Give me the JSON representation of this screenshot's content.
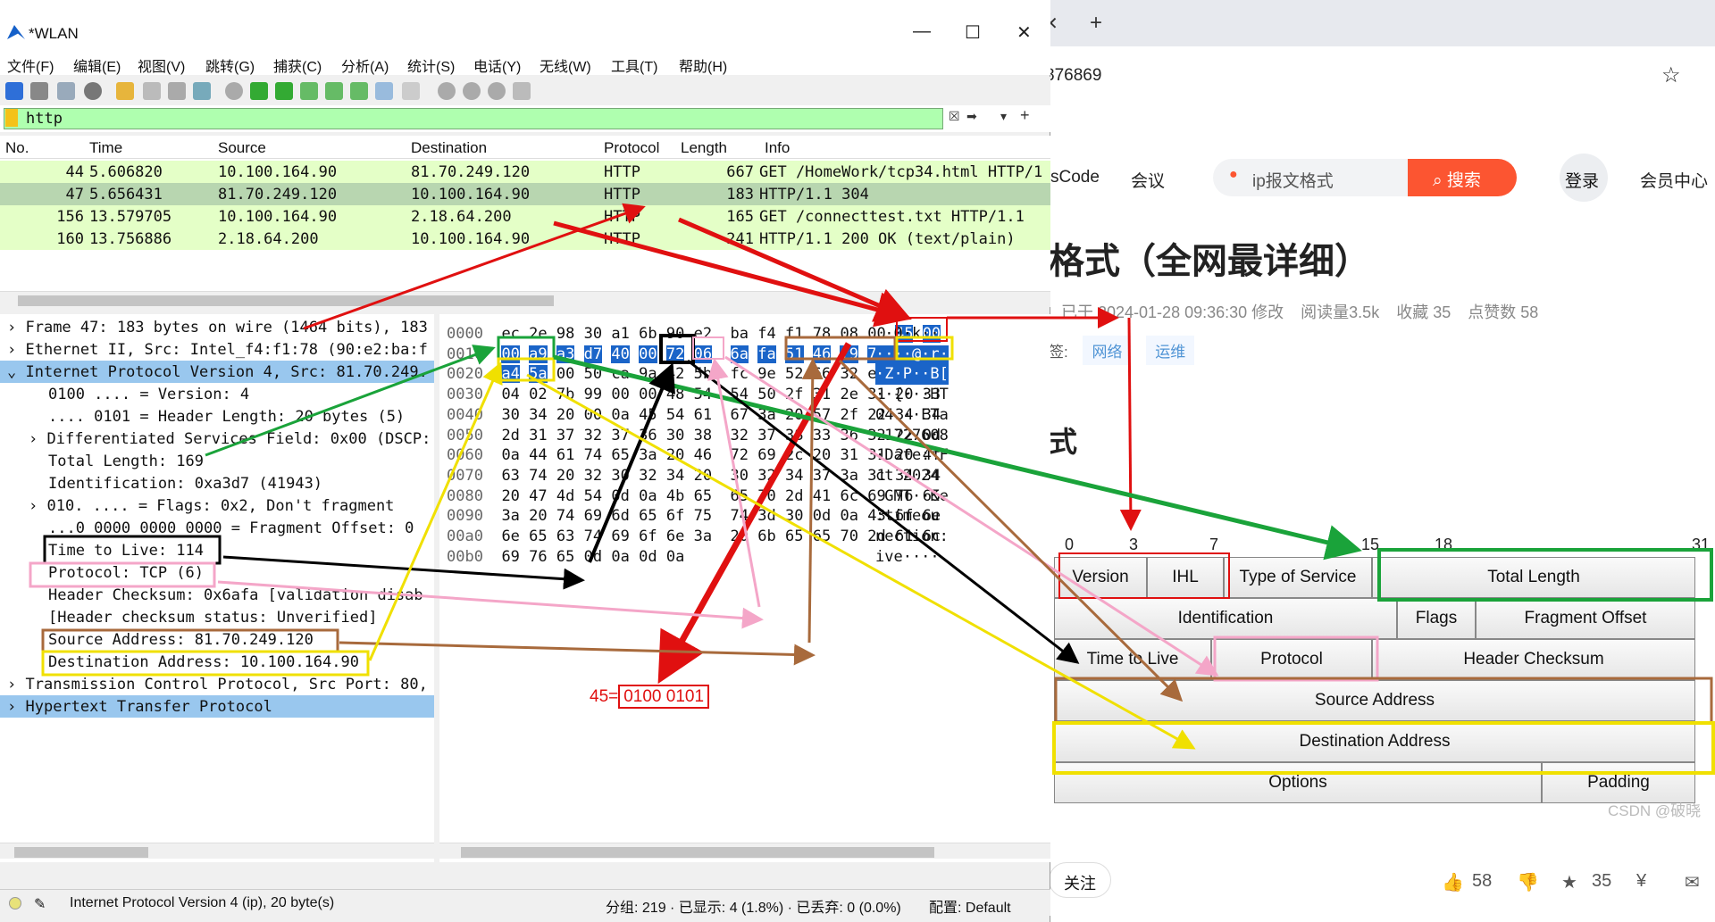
{
  "browser": {
    "url_partial": "876869",
    "nav_left": "sCode",
    "nav_meeting": "会议",
    "search_placeholder": "ip报文格式",
    "search_button": "搜索",
    "login": "登录",
    "member": "会员中心",
    "article_title": "格式（全网最详细）",
    "meta": {
      "edited": "已于 2024-01-28 09:36:30 修改",
      "reads": "阅读量3.5k",
      "favorites": "收藏 35",
      "likes": "点赞数 58"
    },
    "tags_label": "签:",
    "tags": [
      "网络",
      "运维"
    ],
    "section_heading": "式",
    "follow": "关注",
    "bottom_likes": "58",
    "bottom_favs": "35",
    "watermark": "CSDN @破晓",
    "ip_header": {
      "bits": [
        "0",
        "3",
        "7",
        "15",
        "18",
        "31"
      ],
      "fields": {
        "version": "Version",
        "ihl": "IHL",
        "tos": "Type of Service",
        "total_length": "Total Length",
        "identification": "Identification",
        "flags": "Flags",
        "fragment_offset": "Fragment Offset",
        "ttl": "Time to Live",
        "protocol": "Protocol",
        "checksum": "Header Checksum",
        "src": "Source Address",
        "dst": "Destination Address",
        "options": "Options",
        "padding": "Padding"
      }
    }
  },
  "wireshark": {
    "title": "*WLAN",
    "menu": [
      "文件(F)",
      "编辑(E)",
      "视图(V)",
      "跳转(G)",
      "捕获(C)",
      "分析(A)",
      "统计(S)",
      "电话(Y)",
      "无线(W)",
      "工具(T)",
      "帮助(H)"
    ],
    "filter": "http",
    "columns": [
      "No.",
      "Time",
      "Source",
      "Destination",
      "Protocol",
      "Length",
      "Info"
    ],
    "packets": [
      {
        "no": "44",
        "time": "5.606820",
        "src": "10.100.164.90",
        "dst": "81.70.249.120",
        "proto": "HTTP",
        "len": "667",
        "info": "GET /HomeWork/tcp34.html HTTP/1"
      },
      {
        "no": "47",
        "time": "5.656431",
        "src": "81.70.249.120",
        "dst": "10.100.164.90",
        "proto": "HTTP",
        "len": "183",
        "info": "HTTP/1.1 304"
      },
      {
        "no": "156",
        "time": "13.579705",
        "src": "10.100.164.90",
        "dst": "2.18.64.200",
        "proto": "HTTP",
        "len": "165",
        "info": "GET /connecttest.txt HTTP/1.1"
      },
      {
        "no": "160",
        "time": "13.756886",
        "src": "2.18.64.200",
        "dst": "10.100.164.90",
        "proto": "HTTP",
        "len": "241",
        "info": "HTTP/1.1 200 OK  (text/plain)"
      }
    ],
    "details": [
      "Frame 47: 183 bytes on wire (1464 bits), 183",
      "Ethernet II, Src: Intel_f4:f1:78 (90:e2:ba:f",
      "Internet Protocol Version 4, Src: 81.70.249.",
      "0100 .... = Version: 4",
      ".... 0101 = Header Length: 20 bytes (5)",
      "Differentiated Services Field: 0x00 (DSCP:",
      "Total Length: 169",
      "Identification: 0xa3d7 (41943)",
      "010. .... = Flags: 0x2, Don't fragment",
      "...0 0000 0000 0000 = Fragment Offset: 0",
      "Time to Live: 114",
      "Protocol: TCP (6)",
      "Header Checksum: 0x6afa [validation disab",
      "[Header checksum status: Unverified]",
      "Source Address: 81.70.249.120",
      "Destination Address: 10.100.164.90",
      "Transmission Control Protocol, Src Port: 80,",
      "Hypertext Transfer Protocol"
    ],
    "bytes": [
      {
        "off": "0000",
        "hex": "ec 2e 98 30 a1 6b 90 e2  ba f4 f1 78 08 00 45 00",
        "ascii": ".·0·k··"
      },
      {
        "off": "0010",
        "hex": "00 a9 a3 d7 40 00 72 06  6a fa 51 46 f9 78 0a 64",
        "ascii": "····@·r·"
      },
      {
        "off": "0020",
        "hex": "a4 5a 00 50 ca 9a 42 5b  fc 9e 52 66 32 e4 50 18",
        "ascii": "·Z·P··B["
      },
      {
        "off": "0030",
        "hex": "04 02 7b 99 00 00 48 54  54 50 2f 31 2e 31 20 33",
        "ascii": "··{···HT"
      },
      {
        "off": "0040",
        "hex": "30 34 20 00 0a 45 54 61  67 3a 20 57 2f 22 34 34",
        "ascii": "04 ··ETa"
      },
      {
        "off": "0050",
        "hex": "2d 31 37 32 37 36 30 38  32 37 38 33 36 32 22 0d",
        "ascii": "-1727608"
      },
      {
        "off": "0060",
        "hex": "0a 44 61 74 65 3a 20 46  72 69 2c 20 31 31 20 4f",
        "ascii": "·Date: F"
      },
      {
        "off": "0070",
        "hex": "63 74 20 32 30 32 34 20  30 32 34 37 3a 31 34 34",
        "ascii": "ct 2024 "
      },
      {
        "off": "0080",
        "hex": "20 47 4d 54 0d 0a 4b 65  65 70 2d 41 6c 69 76 65",
        "ascii": " GMT··Ke"
      },
      {
        "off": "0090",
        "hex": "3a 20 74 69 6d 65 6f 75  74 3d 30 0d 0a 43 6f 6e",
        "ascii": ":timeou"
      },
      {
        "off": "00a0",
        "hex": "6e 65 63 74 69 6f 6e 3a  20 6b 65 65 70 2d 61 6c",
        "ascii": "nection:"
      },
      {
        "off": "00b0",
        "hex": "69 76 65 0d 0a 0d 0a",
        "ascii": "ive····"
      }
    ],
    "status": {
      "field": "Internet Protocol Version 4 (ip), 20 byte(s)",
      "stats": "分组: 219 · 已显示: 4 (1.8%) · 已丢弃: 0 (0.0%)",
      "profile": "配置: Default"
    },
    "annotation": {
      "left": "45=",
      "right": "0100 0101"
    }
  },
  "colors": {
    "red": "#e01010",
    "green": "#1aa33a",
    "yellow": "#f0e000",
    "brown": "#a86a3c",
    "pink": "#f4a6c8",
    "black": "#000000",
    "selected_row": "#b8d6b0",
    "http_row": "#e4ffc7",
    "filter_bg": "#afffaf"
  }
}
